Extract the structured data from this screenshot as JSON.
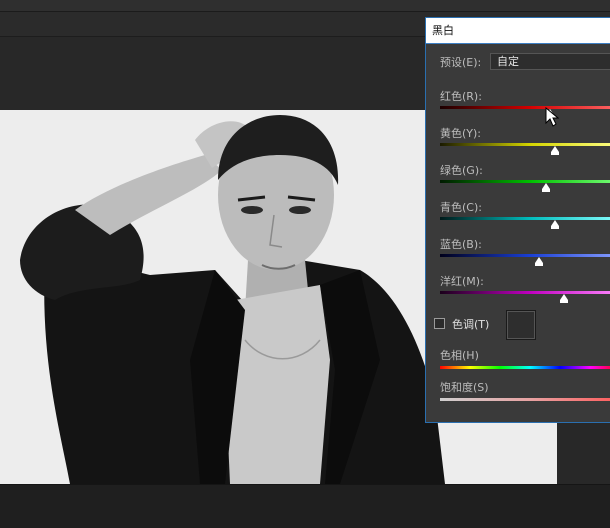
{
  "dialog": {
    "title": "黑白",
    "preset": {
      "label": "预设(E):",
      "value": "自定"
    },
    "sliders": [
      {
        "label": "红色(R):",
        "value_fraction": 0.61
      },
      {
        "label": "黄色(Y):",
        "value_fraction": 0.64
      },
      {
        "label": "绿色(G):",
        "value_fraction": 0.59
      },
      {
        "label": "青色(C):",
        "value_fraction": 0.64
      },
      {
        "label": "蓝色(B):",
        "value_fraction": 0.55
      },
      {
        "label": "洋红(M):",
        "value_fraction": 0.69
      }
    ],
    "tint": {
      "label": "色调(T)",
      "checked": false
    },
    "hue_label": "色相(H)",
    "saturation_label": "饱和度(S)"
  },
  "colors": {
    "red_track": [
      "#1a0000",
      "#d40000",
      "#ff6a6a"
    ],
    "yellow_track": [
      "#1a1a00",
      "#d4d400",
      "#ffff8a"
    ],
    "green_track": [
      "#001a00",
      "#00c000",
      "#7aff7a"
    ],
    "cyan_track": [
      "#001a1a",
      "#00bcbc",
      "#8affff"
    ],
    "blue_track": [
      "#00001a",
      "#1a3fd4",
      "#8aa0ff"
    ],
    "magenta_track": [
      "#1a001a",
      "#c000c0",
      "#ff8aff"
    ],
    "accent": "#2a6fb0"
  }
}
